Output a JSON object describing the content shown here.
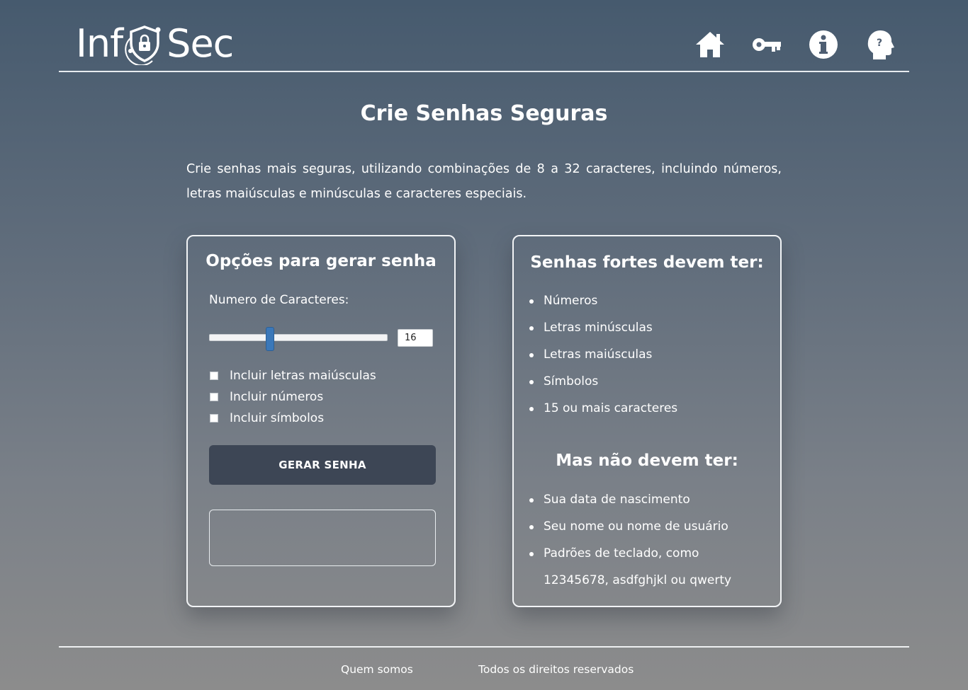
{
  "brand": {
    "name_left": "Inf",
    "name_right": "Sec"
  },
  "nav": [
    {
      "icon": "home-icon"
    },
    {
      "icon": "key-icon"
    },
    {
      "icon": "info-icon"
    },
    {
      "icon": "head-question-icon"
    }
  ],
  "page": {
    "title": "Crie Senhas Seguras",
    "intro": "Crie senhas mais seguras, utilizando combinações de 8 a 32 caracteres, incluindo números, letras maiúsculas e minúsculas e caracteres especiais."
  },
  "generator": {
    "title": "Opções para gerar senha",
    "length_label": "Numero de Caracteres:",
    "length_value": "16",
    "slider_min": 8,
    "slider_max": 32,
    "options": [
      {
        "label": "Incluir letras maiúsculas",
        "checked": false
      },
      {
        "label": "Incluir números",
        "checked": false
      },
      {
        "label": "Incluir símbolos",
        "checked": false
      }
    ],
    "button_label": "GERAR SENHA",
    "result_value": ""
  },
  "tips": {
    "title_must": "Senhas fortes devem ter:",
    "must": [
      "Números",
      "Letras minúsculas",
      "Letras maiúsculas",
      "Símbolos",
      "15 ou mais caracteres"
    ],
    "title_must_not": "Mas não devem ter:",
    "must_not": [
      "Sua data de nascimento",
      "Seu nome ou nome de usuário",
      "Padrões de teclado, como"
    ],
    "must_not_continued": "12345678, asdfghjkl ou qwerty"
  },
  "footer": {
    "about": "Quem somos",
    "rights": "Todos os direitos reservados"
  },
  "colors": {
    "button_bg": "#3d4655",
    "slider_thumb": "#3b78b9"
  }
}
